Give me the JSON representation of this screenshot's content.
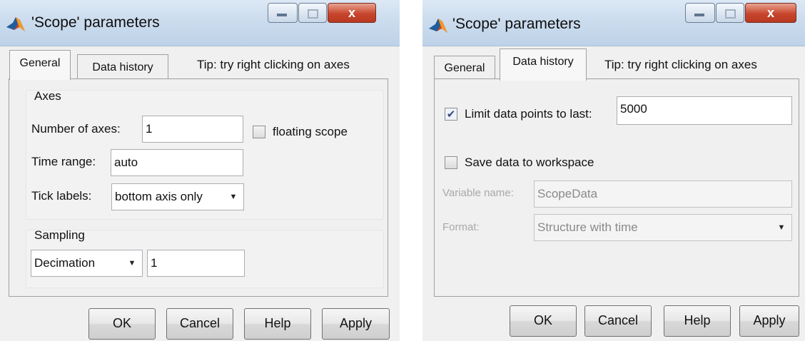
{
  "left_dialog": {
    "title": "'Scope' parameters",
    "window_controls": {
      "close_glyph": "x"
    },
    "tabs": {
      "general": "General",
      "data_history": "Data history"
    },
    "tip": "Tip: try right clicking on axes",
    "axes_group": {
      "title": "Axes",
      "number_of_axes_label": "Number of axes:",
      "number_of_axes_value": "1",
      "floating_scope_label": "floating scope",
      "floating_scope_checked": false,
      "time_range_label": "Time range:",
      "time_range_value": "auto",
      "tick_labels_label": "Tick labels:",
      "tick_labels_value": "bottom axis only"
    },
    "sampling_group": {
      "title": "Sampling",
      "mode_value": "Decimation",
      "factor_value": "1"
    },
    "buttons": {
      "ok": "OK",
      "cancel": "Cancel",
      "help": "Help",
      "apply": "Apply"
    }
  },
  "right_dialog": {
    "title": "'Scope' parameters",
    "window_controls": {
      "close_glyph": "x"
    },
    "tabs": {
      "general": "General",
      "data_history": "Data history"
    },
    "tip": "Tip: try right clicking on axes",
    "limit_points_label": "Limit data points to last:",
    "limit_points_checked": true,
    "limit_points_value": "5000",
    "save_workspace_label": "Save data to workspace",
    "save_workspace_checked": false,
    "variable_name_label": "Variable name:",
    "variable_name_value": "ScopeData",
    "format_label": "Format:",
    "format_value": "Structure with time",
    "buttons": {
      "ok": "OK",
      "cancel": "Cancel",
      "help": "Help",
      "apply": "Apply"
    }
  },
  "icons": {
    "app": "matlab-icon",
    "minimize": "minimize-icon",
    "maximize": "maximize-icon",
    "close": "close-icon",
    "checkmark": "checkmark-icon",
    "dropdown": "chevron-down-icon"
  },
  "glyphs": {
    "checkmark": "✔",
    "dropdown": "▼"
  },
  "colors": {
    "titlebar": "#c9dbee",
    "close_button": "#c8452d",
    "dialog_bg": "#f0f0f0"
  }
}
